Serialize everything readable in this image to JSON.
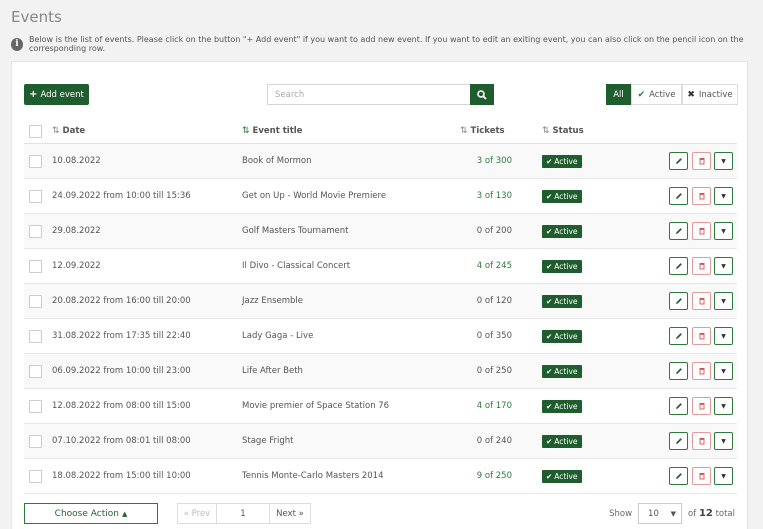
{
  "page": {
    "title": "Events",
    "info": "Below is the list of events. Please click on the button \"+ Add event\" if you want to add new event. If you want to edit an exiting event, you can also click on the pencil icon on the corresponding row."
  },
  "toolbar": {
    "add_label": "Add event",
    "search_placeholder": "Search",
    "filters": {
      "all": "All",
      "active": "Active",
      "inactive": "Inactive"
    }
  },
  "table": {
    "columns": {
      "date": "Date",
      "title": "Event title",
      "tickets": "Tickets",
      "status": "Status"
    },
    "rows": [
      {
        "date": "10.08.2022",
        "title": "Book of Mormon",
        "tickets": "3 of 300",
        "tickets_sold": true,
        "status": "Active"
      },
      {
        "date": "24.09.2022 from 10:00 till 15:36",
        "title": "Get on Up - World Movie Premiere",
        "tickets": "3 of 130",
        "tickets_sold": true,
        "status": "Active"
      },
      {
        "date": "29.08.2022",
        "title": "Golf Masters Tournament",
        "tickets": "0 of 200",
        "tickets_sold": false,
        "status": "Active"
      },
      {
        "date": "12.09.2022",
        "title": "Il Divo - Classical Concert",
        "tickets": "4 of 245",
        "tickets_sold": true,
        "status": "Active"
      },
      {
        "date": "20.08.2022 from 16:00 till 20:00",
        "title": "Jazz Ensemble",
        "tickets": "0 of 120",
        "tickets_sold": false,
        "status": "Active"
      },
      {
        "date": "31.08.2022 from 17:35 till 22:40",
        "title": "Lady Gaga - Live",
        "tickets": "0 of 350",
        "tickets_sold": false,
        "status": "Active"
      },
      {
        "date": "06.09.2022 from 10:00 till 23:00",
        "title": "Life After Beth",
        "tickets": "0 of 250",
        "tickets_sold": false,
        "status": "Active"
      },
      {
        "date": "12.08.2022 from 08:00 till 15:00",
        "title": "Movie premier of Space Station 76",
        "tickets": "4 of 170",
        "tickets_sold": true,
        "status": "Active"
      },
      {
        "date": "07.10.2022 from 08:01 till 08:00",
        "title": "Stage Fright",
        "tickets": "0 of 240",
        "tickets_sold": false,
        "status": "Active"
      },
      {
        "date": "18.08.2022 from 15:00 till 10:00",
        "title": "Tennis Monte-Carlo Masters 2014",
        "tickets": "9 of 250",
        "tickets_sold": true,
        "status": "Active"
      }
    ]
  },
  "footer": {
    "choose_action": "Choose Action",
    "pager": {
      "prev": "« Prev",
      "page": "1",
      "next": "Next »"
    },
    "show_label": "Show",
    "page_size": "10",
    "of_label": "of",
    "total_count": "12",
    "total_label": "total"
  },
  "colors": {
    "accent": "#1f5c2e",
    "delete": "#d9534f"
  }
}
